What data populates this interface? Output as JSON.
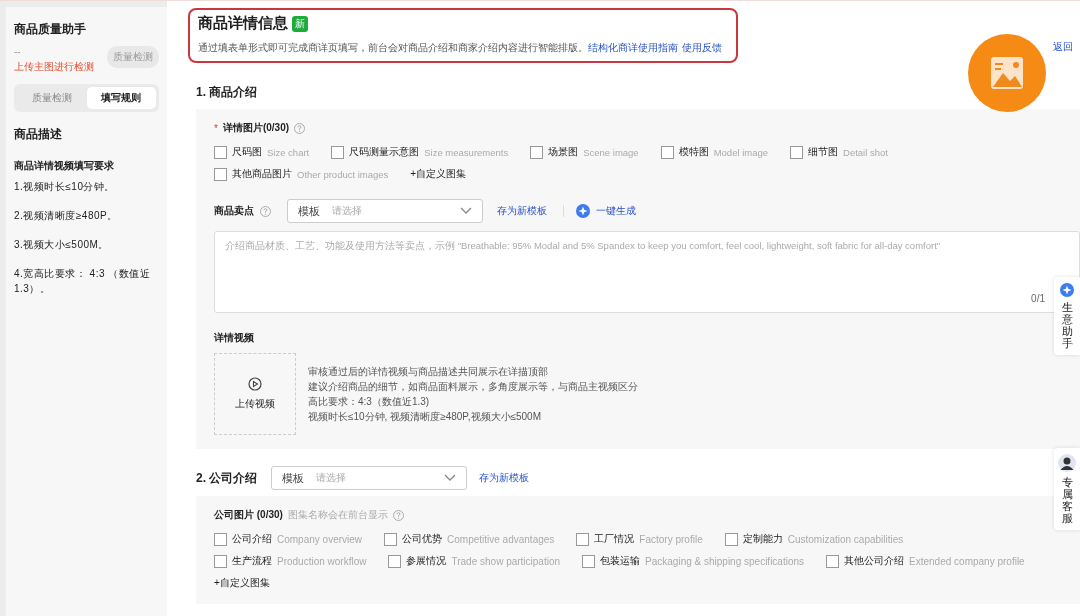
{
  "sidebar": {
    "title": "商品质量助手",
    "dash": "--",
    "upload_hint": "上传主图进行检测",
    "check_button": "质量检测",
    "tabs": [
      {
        "label": "质量检测",
        "selected": false
      },
      {
        "label": "填写规则",
        "selected": true
      }
    ],
    "section_title": "商品描述",
    "rules_title": "商品详情视频填写要求",
    "rules": [
      "1.视频时长≤10分钟。",
      "2.视频清晰度≥480P。",
      "3.视频大小≤500M。",
      "4.宽高比要求： 4:3 （数值近1.3）。"
    ]
  },
  "header": {
    "title": "商品详情信息",
    "badge": "新",
    "description": "通过填表单形式即可完成商详页填写，前台会对商品介绍和商家介绍内容进行智能排版。",
    "links": [
      "结构化商详使用指南",
      "使用反馈"
    ]
  },
  "back_link": "返回",
  "product_intro": {
    "title": "1. 商品介绍",
    "images": {
      "required_mark": "*",
      "label": "详情图片(0/30)",
      "options": [
        {
          "label": "尺码图",
          "hint": "Size chart",
          "checked": false
        },
        {
          "label": "尺码测量示意图",
          "hint": "Size measurements",
          "checked": false
        },
        {
          "label": "场景图",
          "hint": "Scene image",
          "checked": false
        },
        {
          "label": "模特图",
          "hint": "Model image",
          "checked": false
        },
        {
          "label": "细节图",
          "hint": "Detail shot",
          "checked": false
        },
        {
          "label": "其他商品图片",
          "hint": "Other product images",
          "checked": false
        }
      ],
      "add_label": "+自定义图集"
    },
    "selling_points": {
      "label": "商品卖点",
      "template_label": "模板",
      "placeholder": "请选择",
      "save_link": "存为新模板",
      "generate_link": "一键生成",
      "text_placeholder": "介绍商品材质、工艺、功能及使用方法等卖点，示例 \"Breathable: 95% Modal and 5% Spandex to keep you comfort, feel cool, lightweight, soft fabric for all-day comfort\"",
      "counter": "0/1"
    },
    "video": {
      "label": "详情视频",
      "upload": "上传视频",
      "notes": [
        "审核通过后的详情视频与商品描述共同展示在详描顶部",
        "建议介绍商品的细节，如商品面料展示，多角度展示等，与商品主视频区分",
        "高比要求：4:3（数值近1.3)",
        "视频时长≤10分钟, 视频清晰度≥480P,视频大小≤500M"
      ]
    }
  },
  "company_intro": {
    "title": "2. 公司介绍",
    "template_label": "模板",
    "placeholder": "请选择",
    "save_link": "存为新模板",
    "images": {
      "label": "公司图片 (0/30)",
      "hint": "图集名称会在前台显示",
      "options": [
        {
          "label": "公司介绍",
          "hint": "Company overview",
          "checked": false
        },
        {
          "label": "公司优势",
          "hint": "Competitive advantages",
          "checked": false
        },
        {
          "label": "工厂情况",
          "hint": "Factory profile",
          "checked": false
        },
        {
          "label": "定制能力",
          "hint": "Customization capabilities",
          "checked": false
        },
        {
          "label": "生产流程",
          "hint": "Production workflow",
          "checked": false
        },
        {
          "label": "参展情况",
          "hint": "Trade show participation",
          "checked": false
        },
        {
          "label": "包装运输",
          "hint": "Packaging & shipping specifications",
          "checked": false
        },
        {
          "label": "其他公司介绍",
          "hint": "Extended company profile",
          "checked": false
        }
      ],
      "add_label": "+自定义图集"
    }
  },
  "float_tabs": [
    {
      "kind": "assistant",
      "label": "生意助手"
    },
    {
      "kind": "service",
      "label": "专属客服"
    }
  ]
}
